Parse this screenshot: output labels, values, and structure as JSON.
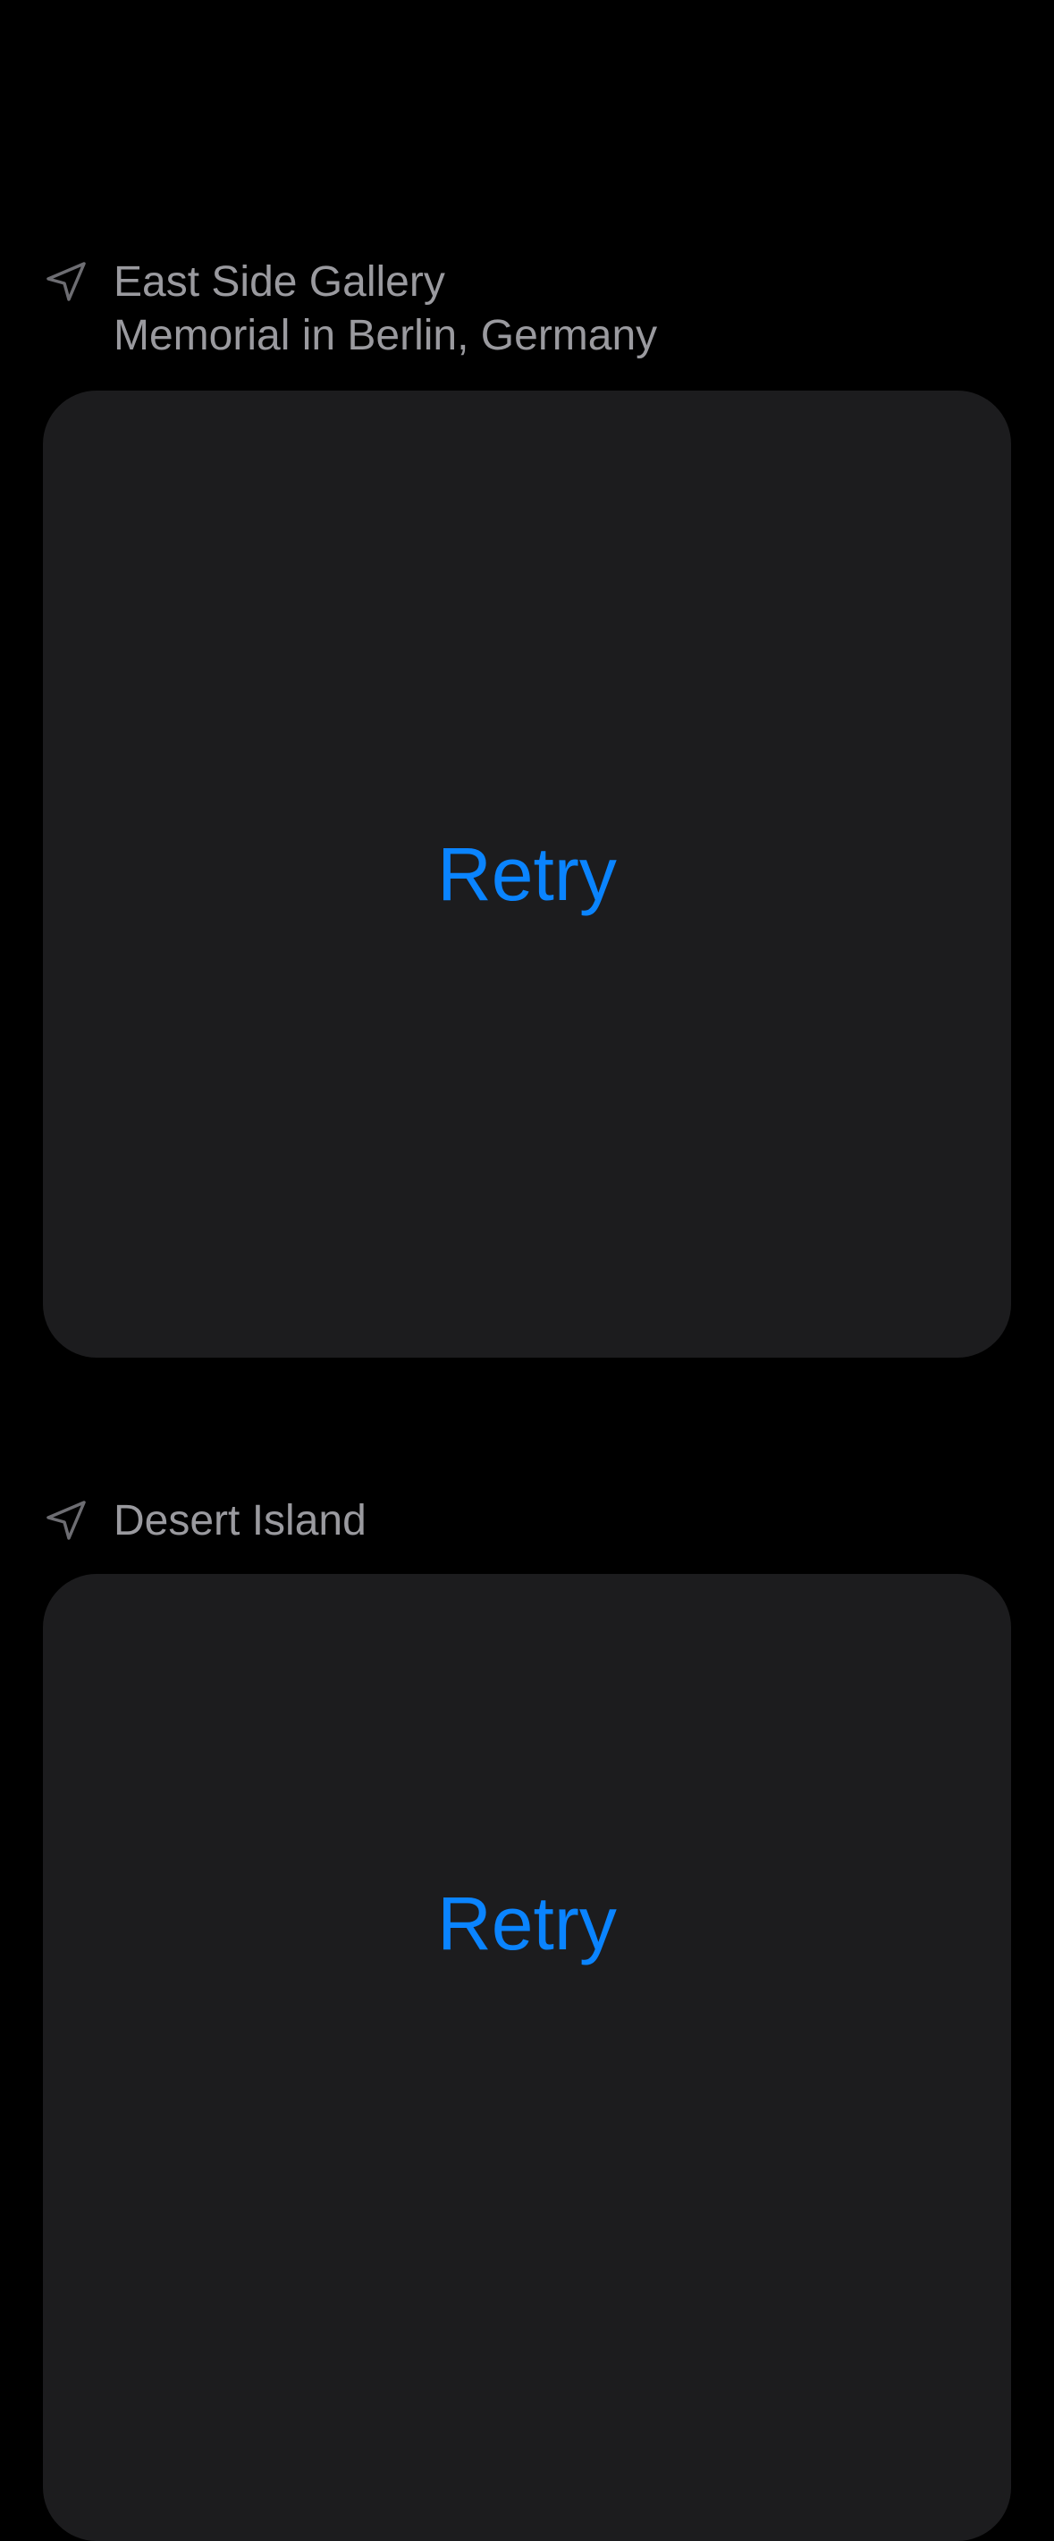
{
  "colors": {
    "background": "#000000",
    "card": "#1c1c1e",
    "secondary_text": "#9a9a9f",
    "accent": "#0a84ff"
  },
  "posts": [
    {
      "location_icon": "location-arrow-icon",
      "title": "East Side Gallery",
      "subtitle": "Memorial in Berlin, Germany",
      "action_label": "Retry"
    },
    {
      "location_icon": "location-arrow-icon",
      "title": "Desert Island",
      "subtitle": "",
      "action_label": "Retry"
    }
  ]
}
